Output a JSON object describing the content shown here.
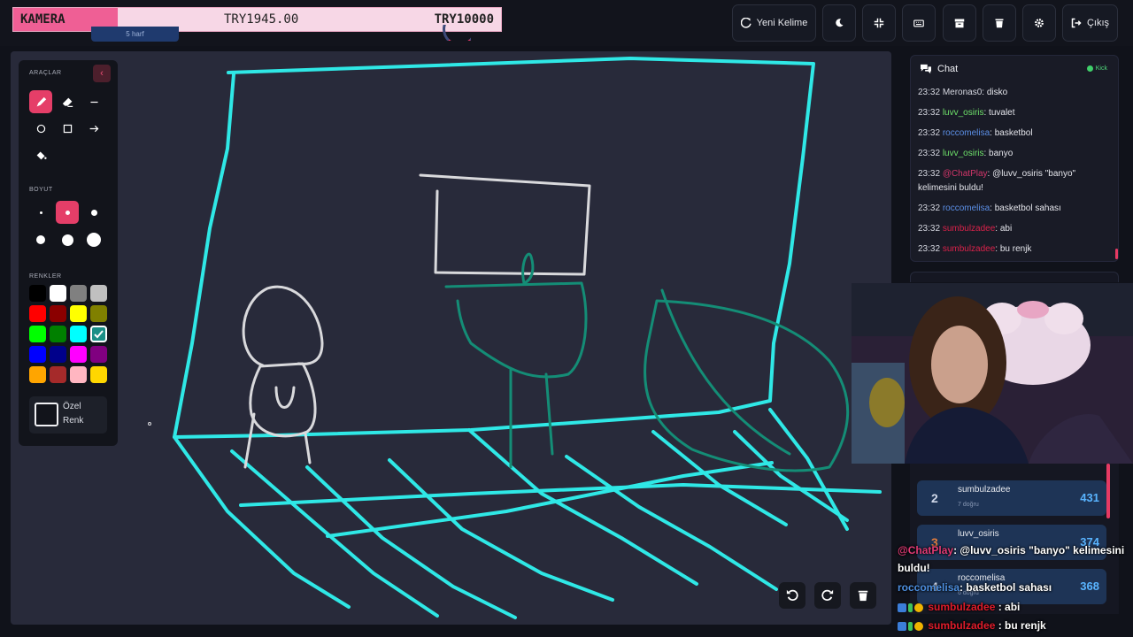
{
  "donation": {
    "label": "KAMERA",
    "current": "TRY1945.00",
    "goal": "TRY10000",
    "progress": 0.1945,
    "under_text": "5 harf"
  },
  "toolbar": {
    "new_word": "Yeni Kelime",
    "exit": "Çıkış"
  },
  "tools": {
    "section_tools": "ARAÇLAR",
    "section_size": "BOYUT",
    "section_colors": "RENKLER",
    "custom_color_line1": "Özel",
    "custom_color_line2": "Renk",
    "selected_tool": "pen",
    "selected_size_index": 1,
    "selected_color": "#40e0d0",
    "colors": [
      "#000000",
      "#ffffff",
      "#808080",
      "#c0c0c0",
      "#ff0000",
      "#8b0000",
      "#ffff00",
      "#808000",
      "#00ff00",
      "#008000",
      "#00ffff",
      "#40e0d0",
      "#0000ff",
      "#00008b",
      "#ff00ff",
      "#800080",
      "#ffa500",
      "#a52a2a",
      "#ffb6c1",
      "#ffd700"
    ]
  },
  "chat": {
    "title": "Chat",
    "platform": "Kick",
    "messages": [
      {
        "time": "23:32",
        "user": "Meronas0",
        "text": ": disko",
        "color": "#d6d8e1"
      },
      {
        "time": "23:32",
        "user": "luvv_osiris",
        "text": ": tuvalet",
        "color": "#6ee06a"
      },
      {
        "time": "23:32",
        "user": "roccomelisa",
        "text": ": basketbol",
        "color": "#5b8fe6"
      },
      {
        "time": "23:32",
        "user": "luvv_osiris",
        "text": ": banyo",
        "color": "#6ee06a"
      },
      {
        "time": "23:32",
        "user": "@ChatPlay",
        "text": ": @luvv_osiris \"banyo\" kelimesini buldu!",
        "color": "#d2366a"
      },
      {
        "time": "23:32",
        "user": "roccomelisa",
        "text": ": basketbol sahası",
        "color": "#5b8fe6"
      },
      {
        "time": "23:32",
        "user": "sumbulzadee",
        "text": ": abi",
        "color": "#d9224a"
      },
      {
        "time": "23:32",
        "user": "sumbulzadee",
        "text": ": bu renjk",
        "color": "#d9224a"
      }
    ]
  },
  "leaderboard": [
    {
      "rank": "2",
      "name": "sumbulzadee",
      "sub": "7 doğru",
      "score": "431"
    },
    {
      "rank": "3",
      "name": "luvv_osiris",
      "sub": "",
      "score": "374"
    },
    {
      "rank": "4",
      "name": "roccomelisa",
      "sub": "6 doğru",
      "score": "368"
    }
  ],
  "overlay_chat": {
    "line1_user": "@ChatPlay",
    "line1_text": ": @luvv_osiris \"banyo\" kelimesini buldu!",
    "line2_user": "roccomelisa",
    "line2_text": ": basketbol sahası",
    "line3_user": "sumbulzadee",
    "line3_text": " : abi",
    "line4_user": "sumbulzadee",
    "line4_text": " : bu renjk"
  }
}
